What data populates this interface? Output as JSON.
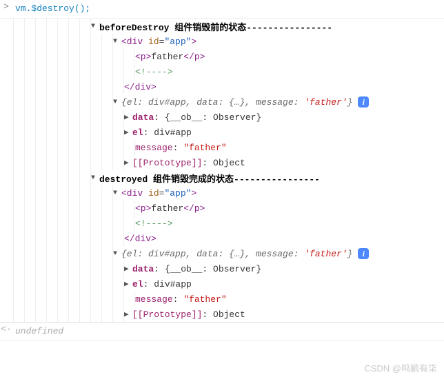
{
  "input": {
    "prompt": ">",
    "code": "vm.$destroy();"
  },
  "group1": {
    "title": "beforeDestroy 组件销毁前的状态----------------",
    "dom": {
      "div_open": "<div",
      "id_attr": "id",
      "id_val": "\"app\"",
      "div_open_end": ">",
      "p_open": "<p>",
      "p_text": "father",
      "p_close": "</p>",
      "comment": "<!---->",
      "div_close": "</div>"
    },
    "obj": {
      "summary_pre": "{el: div#app, data: {…}, message: ",
      "summary_msg": "'father'",
      "summary_post": "}",
      "data_label": "data",
      "data_val": "{__ob__: Observer}",
      "el_label": "el",
      "el_val": "div#app",
      "msg_label": "message",
      "msg_val": "\"father\"",
      "proto_label": "[[Prototype]]",
      "proto_val": "Object"
    }
  },
  "group2": {
    "title": "destroyed 组件销毁完成的状态----------------",
    "dom": {
      "div_open": "<div",
      "id_attr": "id",
      "id_val": "\"app\"",
      "div_open_end": ">",
      "p_open": "<p>",
      "p_text": "father",
      "p_close": "</p>",
      "comment": "<!---->",
      "div_close": "</div>"
    },
    "obj": {
      "summary_pre": "{el: div#app, data: {…}, message: ",
      "summary_msg": "'father'",
      "summary_post": "}",
      "data_label": "data",
      "data_val": "{__ob__: Observer}",
      "el_label": "el",
      "el_val": "div#app",
      "msg_label": "message",
      "msg_val": "\"father\"",
      "proto_label": "[[Prototype]]",
      "proto_val": "Object"
    }
  },
  "return": {
    "prompt": "<·",
    "value": "undefined"
  },
  "watermark": "CSDN @鸣鹂有柒"
}
